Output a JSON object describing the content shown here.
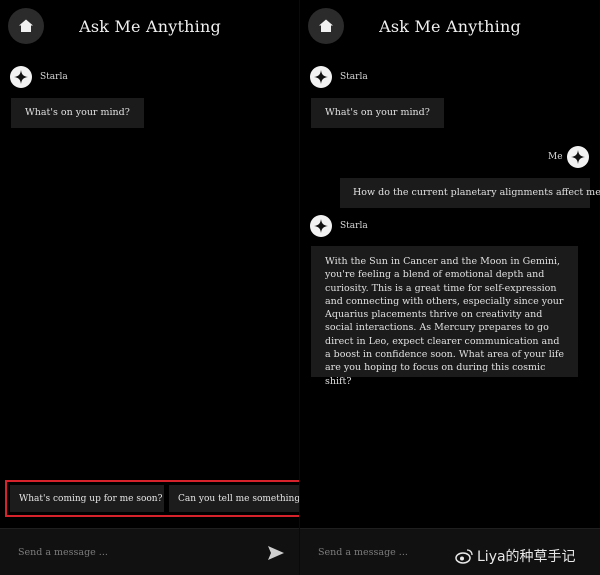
{
  "app": {
    "title": "Ask Me Anything"
  },
  "left": {
    "messages": [
      {
        "sender": "Starla",
        "text": "What's on your mind?"
      }
    ],
    "suggestions": [
      "What's coming up for me soon?",
      "Can you tell me something in"
    ],
    "input": {
      "placeholder": "Send a message ..."
    }
  },
  "right": {
    "messages": [
      {
        "sender": "Starla",
        "text": "What's on your mind?"
      },
      {
        "sender": "Me",
        "text": "How do the current planetary alignments affect me?"
      },
      {
        "sender": "Starla",
        "text": "With the Sun in Cancer and the Moon in Gemini, you're feeling a blend of emotional depth and curiosity. This is a great time for self-expression and connecting with others, especially since your Aquarius placements thrive on creativity and social interactions. As Mercury prepares to go direct in Leo, expect clearer communication and a boost in confidence soon. What area of your life are you hoping to focus on during this cosmic shift?"
      }
    ],
    "input": {
      "placeholder": "Send a message ..."
    }
  },
  "watermark": {
    "text": "Liya的种草手记"
  },
  "colors": {
    "highlight": "#d6222a",
    "bubble": "#1b1b1b",
    "background": "#000000"
  },
  "icons": {
    "home": "home-icon",
    "avatar": "sparkle-icon",
    "send": "send-arrow-icon"
  }
}
